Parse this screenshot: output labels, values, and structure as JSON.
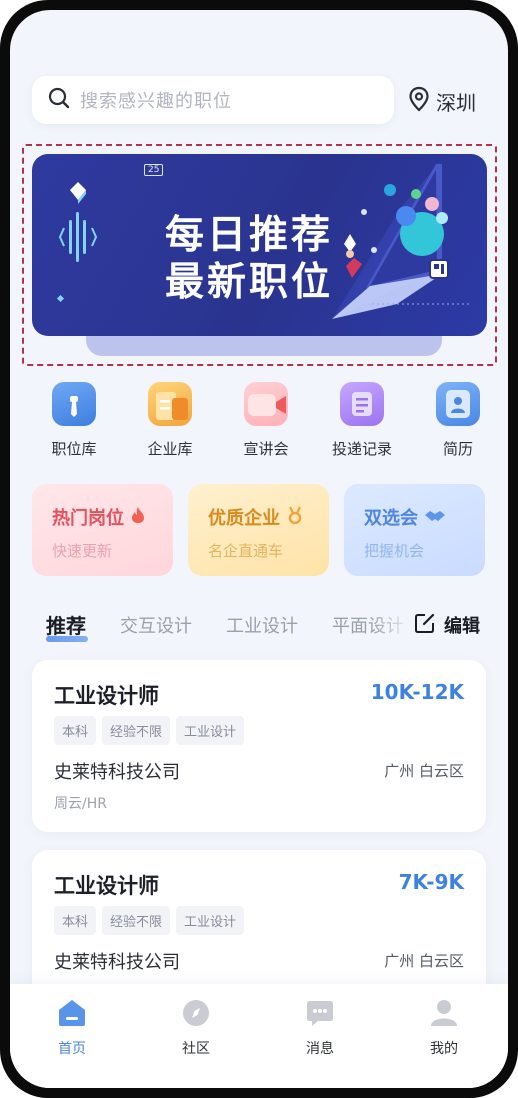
{
  "search": {
    "placeholder": "搜索感兴趣的职位"
  },
  "location": {
    "city": "深圳"
  },
  "banner": {
    "badge": "25",
    "line1": "每日推荐",
    "line2": "最新职位"
  },
  "categories": [
    {
      "label": "职位库",
      "icon": "briefcase-icon"
    },
    {
      "label": "企业库",
      "icon": "building-icon"
    },
    {
      "label": "宣讲会",
      "icon": "video-camera-icon"
    },
    {
      "label": "投递记录",
      "icon": "document-list-icon"
    },
    {
      "label": "简历",
      "icon": "resume-icon"
    }
  ],
  "features": [
    {
      "title": "热门岗位",
      "subtitle": "快速更新",
      "icon": "flame-icon",
      "accent": "#e2535e"
    },
    {
      "title": "优质企业",
      "subtitle": "名企直通车",
      "icon": "medal-icon",
      "accent": "#d98b1f"
    },
    {
      "title": "双选会",
      "subtitle": "把握机会",
      "icon": "handshake-icon",
      "accent": "#4f86de"
    }
  ],
  "tabs": [
    "推荐",
    "交互设计",
    "工业设计",
    "平面设计"
  ],
  "edit_label": "编辑",
  "jobs": [
    {
      "title": "工业设计师",
      "salary": "10K-12K",
      "tags": [
        "本科",
        "经验不限",
        "工业设计"
      ],
      "company": "史莱特科技公司",
      "area": "广州 白云区",
      "contact": "周云/HR"
    },
    {
      "title": "工业设计师",
      "salary": "7K-9K",
      "tags": [
        "本科",
        "经验不限",
        "工业设计"
      ],
      "company": "史莱特科技公司",
      "area": "广州 白云区"
    }
  ],
  "nav": [
    {
      "label": "首页",
      "icon": "home-icon",
      "active": true
    },
    {
      "label": "社区",
      "icon": "compass-icon",
      "active": false
    },
    {
      "label": "消息",
      "icon": "chat-icon",
      "active": false
    },
    {
      "label": "我的",
      "icon": "user-icon",
      "active": false
    }
  ],
  "colors": {
    "accent": "#3d82e0",
    "banner": "#2f3aa0",
    "background": "#f2f5fb"
  }
}
